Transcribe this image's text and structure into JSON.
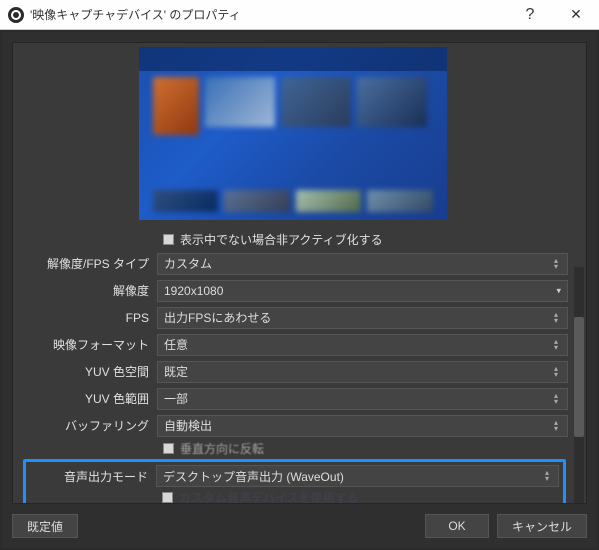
{
  "window": {
    "title": "'映像キャプチャデバイス' のプロパティ"
  },
  "checkbox_deactivate": "表示中でない場合非アクティブ化する",
  "rows": {
    "res_fps_type": {
      "label": "解像度/FPS タイプ",
      "value": "カスタム"
    },
    "resolution": {
      "label": "解像度",
      "value": "1920x1080"
    },
    "fps": {
      "label": "FPS",
      "value": "出力FPSにあわせる"
    },
    "video_format": {
      "label": "映像フォーマット",
      "value": "任意"
    },
    "yuv_space": {
      "label": "YUV 色空間",
      "value": "既定"
    },
    "yuv_range": {
      "label": "YUV 色範囲",
      "value": "一部"
    },
    "buffering": {
      "label": "バッファリング",
      "value": "自動検出"
    },
    "flip_horiz": {
      "label": "垂直方向に反転"
    },
    "audio_mode": {
      "label": "音声出力モード",
      "value": "デスクトップ音声出力 (WaveOut)"
    },
    "use_custom_audio": {
      "label": "カスタム音声デバイスを使用する"
    }
  },
  "footer": {
    "defaults": "既定値",
    "ok": "OK",
    "cancel": "キャンセル"
  }
}
